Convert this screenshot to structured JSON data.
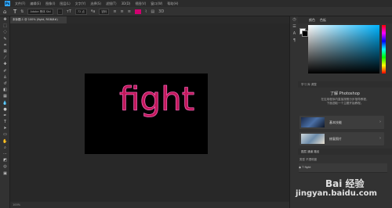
{
  "menubar": {
    "logo": "Ps",
    "items": [
      "文件(F)",
      "编辑(E)",
      "图像(I)",
      "图层(L)",
      "文字(Y)",
      "选择(S)",
      "滤镜(T)",
      "3D(D)",
      "视图(V)",
      "窗口(W)",
      "帮助(H)"
    ]
  },
  "options": {
    "font_family": "Adobe 黑体 Std",
    "font_style": "-",
    "font_size": "72 点",
    "antialias": "锐利",
    "text_color": "#d0006f"
  },
  "document": {
    "tab_label": "未标题-1 @ 100% (fight, RGB/8#)"
  },
  "canvas": {
    "text": "fight",
    "text_color": "#c2185b",
    "background": "#000000"
  },
  "status": {
    "zoom": "100%"
  },
  "color_panel": {
    "tabs": [
      "颜色",
      "色板"
    ],
    "base_hue": "#00b4ff"
  },
  "learn_panel": {
    "tabs": [
      "学习",
      "库",
      "调整"
    ],
    "title": "了解 Photoshop",
    "desc_line1": "在应用程序内直接按照分步指导教程，",
    "desc_line2": "下面选取一个主题开始教程。",
    "cards": [
      {
        "label": "基本技能"
      },
      {
        "label": "修复照片"
      }
    ]
  },
  "layers_panel": {
    "tabs": [
      "图层",
      "通道",
      "路径"
    ],
    "filter_label": "类型",
    "opacity_label": "不透明度",
    "layers": [
      "fight",
      "背景"
    ]
  },
  "watermark": {
    "brand": "Bai 经验",
    "url": "jingyan.baidu.com"
  }
}
